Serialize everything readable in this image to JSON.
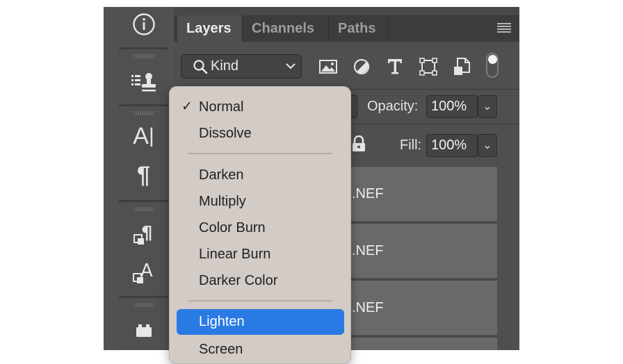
{
  "panel": {
    "tabs": [
      {
        "label": "Layers",
        "active": true
      },
      {
        "label": "Channels",
        "active": false
      },
      {
        "label": "Paths",
        "active": false
      }
    ],
    "menu_icon": "hamburger-icon"
  },
  "filter": {
    "kind_label": "Kind",
    "icons": [
      "image-filter-icon",
      "adjustment-filter-icon",
      "type-filter-icon",
      "shape-filter-icon",
      "smart-object-filter-icon"
    ]
  },
  "blend": {
    "opacity_label": "Opacity:",
    "opacity_value": "100%",
    "fill_label": "Fill:",
    "fill_value": "100%"
  },
  "layers": [
    {
      "name_fragment": ".NEF"
    },
    {
      "name_fragment": ".NEF"
    },
    {
      "name_fragment": ".NEF"
    }
  ],
  "toolstrip": [
    "info-icon",
    "clone-source-icon",
    "character-icon",
    "paragraph-icon",
    "paragraph-styles-icon",
    "character-styles-icon",
    "3d-icon"
  ],
  "blend_menu": {
    "items": [
      {
        "label": "Normal",
        "checked": true
      },
      {
        "label": "Dissolve"
      },
      {
        "label": "Darken"
      },
      {
        "label": "Multiply"
      },
      {
        "label": "Color Burn"
      },
      {
        "label": "Linear Burn"
      },
      {
        "label": "Darker Color"
      },
      {
        "label": "Lighten",
        "highlighted": true
      },
      {
        "label": "Screen"
      }
    ],
    "highlight_color": "#2a7ae4"
  }
}
